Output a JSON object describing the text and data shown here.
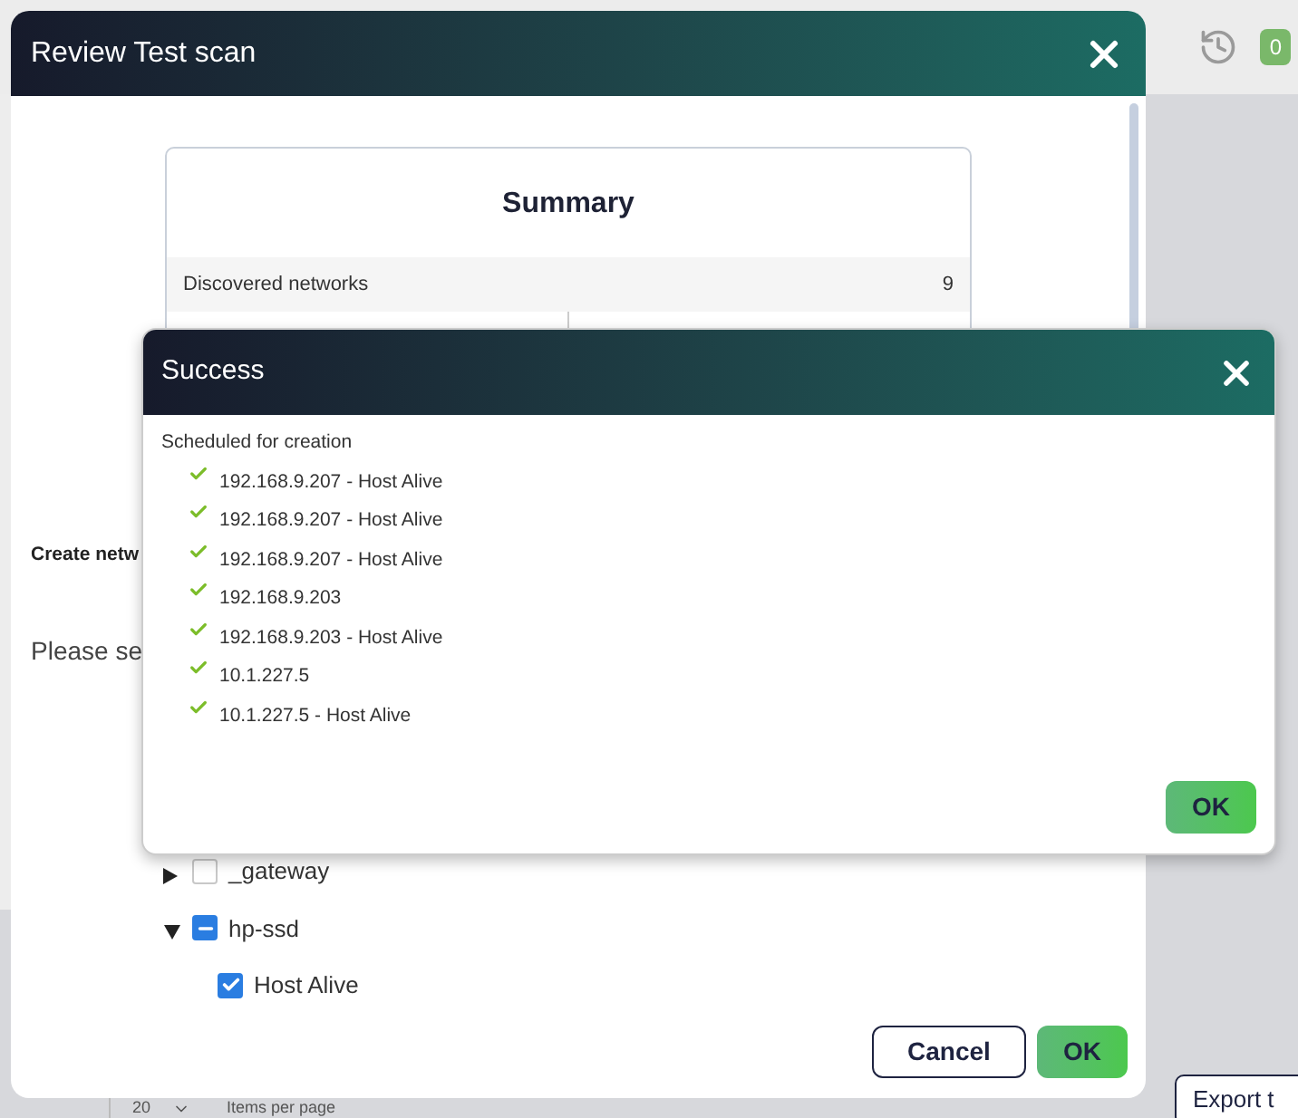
{
  "topbar": {
    "notification_count": "0"
  },
  "background": {
    "page_size": "20",
    "page_size_label": "Items per page",
    "export_button": "Export t"
  },
  "review_dialog": {
    "title": "Review Test scan",
    "summary": {
      "title": "Summary",
      "rows": [
        {
          "label": "Discovered networks",
          "value": "9"
        }
      ]
    },
    "section_label": "Create netw",
    "prompt": "Please se",
    "tree": [
      {
        "label": "_gateway",
        "checked": false,
        "expanded": false
      },
      {
        "label": "hp-ssd",
        "indeterminate": true,
        "expanded": true,
        "children": [
          {
            "label": "Host Alive",
            "checked": true
          }
        ]
      }
    ],
    "buttons": {
      "cancel": "Cancel",
      "ok": "OK"
    }
  },
  "success_dialog": {
    "title": "Success",
    "heading": "Scheduled for creation",
    "items": [
      "192.168.9.207 - Host Alive",
      "192.168.9.207 - Host Alive",
      "192.168.9.207 - Host Alive",
      "192.168.9.203",
      "192.168.9.203 - Host Alive",
      "10.1.227.5",
      "10.1.227.5 - Host Alive"
    ],
    "ok": "OK"
  }
}
